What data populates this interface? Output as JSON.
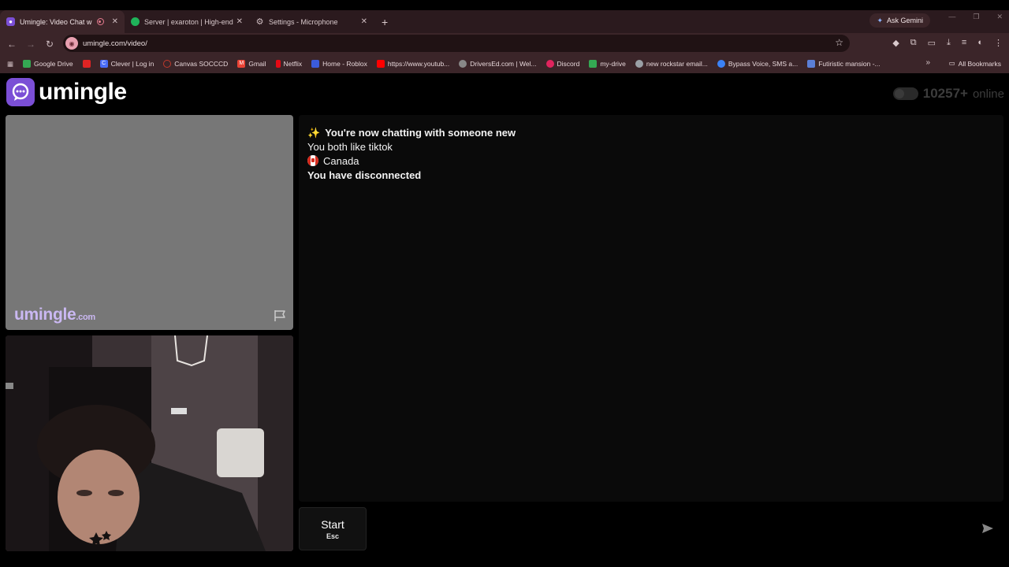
{
  "browser": {
    "tabs": [
      {
        "label": "Umingle: Video Chat with St",
        "active": true,
        "recording": true
      },
      {
        "label": "Server | exaroton | High-end on",
        "active": false
      },
      {
        "label": "Settings - Microphone",
        "active": false
      }
    ],
    "gemini_label": "Ask Gemini",
    "url": "umingle.com/video/",
    "bookmarks": [
      {
        "label": "Google Drive",
        "color": "#34a853"
      },
      {
        "label": "",
        "color": "#e02424"
      },
      {
        "label": "Clever | Log in",
        "color": "#4a6cf7"
      },
      {
        "label": "Canvas SOCCCD",
        "color": "#c0392b"
      },
      {
        "label": "Gmail",
        "color": "#ea4335"
      },
      {
        "label": "Netflix",
        "color": "#e50914"
      },
      {
        "label": "Home - Roblox",
        "color": "#3b5bdb"
      },
      {
        "label": "https://www.youtub...",
        "color": "#ff0000"
      },
      {
        "label": "DriversEd.com | Wel...",
        "color": "#888888"
      },
      {
        "label": "Discord",
        "color": "#e0245e"
      },
      {
        "label": "my-drive",
        "color": "#34a853"
      },
      {
        "label": "new rockstar email...",
        "color": "#9aa0a6"
      },
      {
        "label": "Bypass Voice, SMS a...",
        "color": "#3b82f6"
      },
      {
        "label": "Futiristic mansion -...",
        "color": "#5b7fd6"
      }
    ],
    "all_bookmarks_label": "All Bookmarks"
  },
  "app": {
    "logo_text": "umingle",
    "online_count": "10257+",
    "online_label": "online",
    "watermark_name": "umingle",
    "watermark_domain": ".com"
  },
  "chat": {
    "messages": [
      {
        "text": "You're now chatting with someone new",
        "bold": true,
        "icon": "sparkle-icon"
      },
      {
        "text": "You both like tiktok",
        "bold": false
      },
      {
        "text": "Canada",
        "bold": false,
        "icon": "canada-flag-icon"
      },
      {
        "text": "You have disconnected",
        "bold": true
      }
    ]
  },
  "compose": {
    "start_label": "Start",
    "start_shortcut": "Esc",
    "input_value": "",
    "input_placeholder": ""
  },
  "colors": {
    "accent": "#7b4fd6",
    "tabbar": "#2b1a1e",
    "toolbar": "#3b2529"
  }
}
